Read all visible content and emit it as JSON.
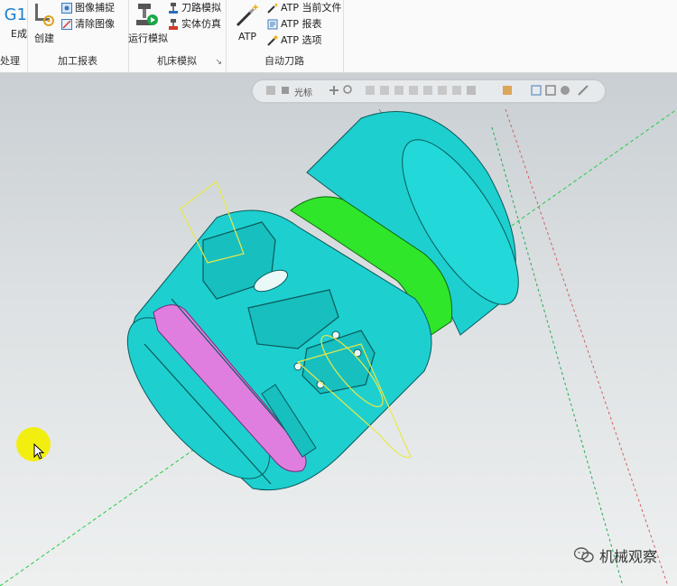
{
  "ribbon": {
    "partial_group": {
      "icon_text": "G1",
      "button_label": "E成",
      "group_label": "处理"
    },
    "machining_report": {
      "group_label": "加工报表",
      "create_label": "创建",
      "image_capture_label": "图像捕捉",
      "clear_image_label": "清除图像"
    },
    "machine_simulation": {
      "group_label": "机床模拟",
      "run_sim_label": "运行模拟",
      "toolpath_sim_label": "刀路模拟",
      "solid_sim_label": "实体仿真"
    },
    "auto_toolpath": {
      "group_label": "自动刀路",
      "atp_label": "ATP",
      "current_file_label": "ATP 当前文件",
      "report_label": "ATP 报表",
      "options_label": "ATP 选项"
    }
  },
  "view_toolbar": {
    "level_label": "光标"
  },
  "watermark": {
    "text": "机械观察"
  },
  "colors": {
    "part_body": "#1ecfcf",
    "stock_selected": "#2fe62a",
    "groove": "#e07ee0",
    "tool_outline": "#e8e84a",
    "axis_line": "#22cc44",
    "cursor_highlight": "#f2ee10"
  }
}
